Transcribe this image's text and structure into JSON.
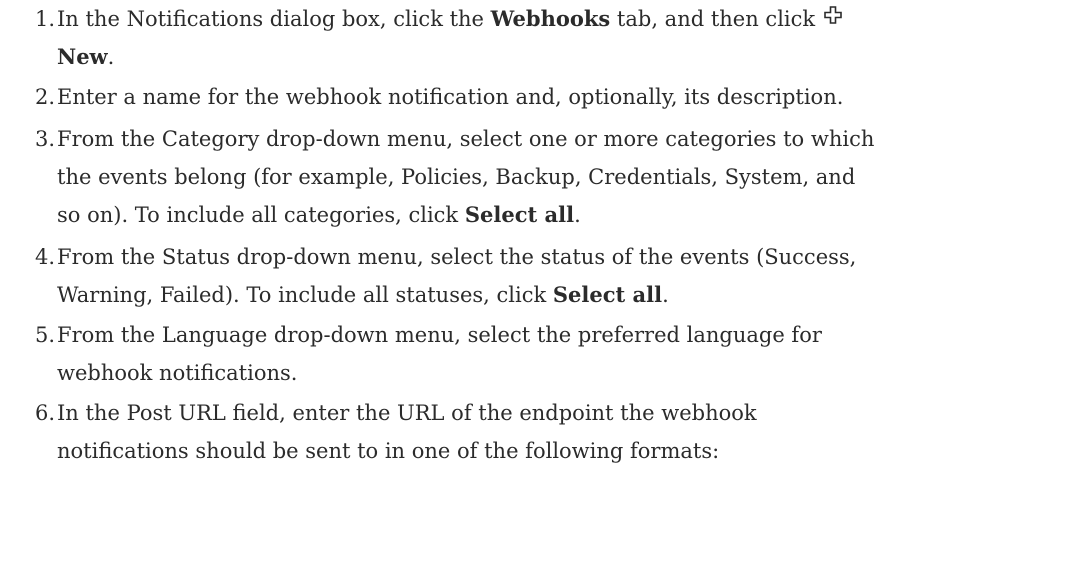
{
  "steps": [
    {
      "number": "1.",
      "pre": "In the Notifications dialog box, click the ",
      "bold1": "Webhooks",
      "mid": " tab, and then click ",
      "icon": "new-plus-icon",
      "bold2": "New",
      "post": "."
    },
    {
      "number": "2.",
      "text": "Enter a name for the webhook notification and, optionally, its description."
    },
    {
      "number": "3.",
      "line1": "From the Category drop-down menu, select one or more categories to which",
      "line2": "the events belong (for example, Policies, Backup, Credentials, System, and",
      "line3_pre": "so on). To include all categories, click ",
      "line3_bold": "Select all",
      "line3_post": "."
    },
    {
      "number": "4.",
      "line1": "From the Status drop-down menu, select the status of the events (Success,",
      "line2_pre": "Warning, Failed). To include all statuses, click ",
      "line2_bold": "Select all",
      "line2_post": "."
    },
    {
      "number": "5.",
      "line1": "From the Language drop-down menu, select the preferred language for",
      "line2": "webhook notifications."
    },
    {
      "number": "6.",
      "line1": "In the Post URL field, enter the URL of the endpoint the webhook",
      "line2": "notifications should be sent to in one of the following formats:"
    }
  ]
}
